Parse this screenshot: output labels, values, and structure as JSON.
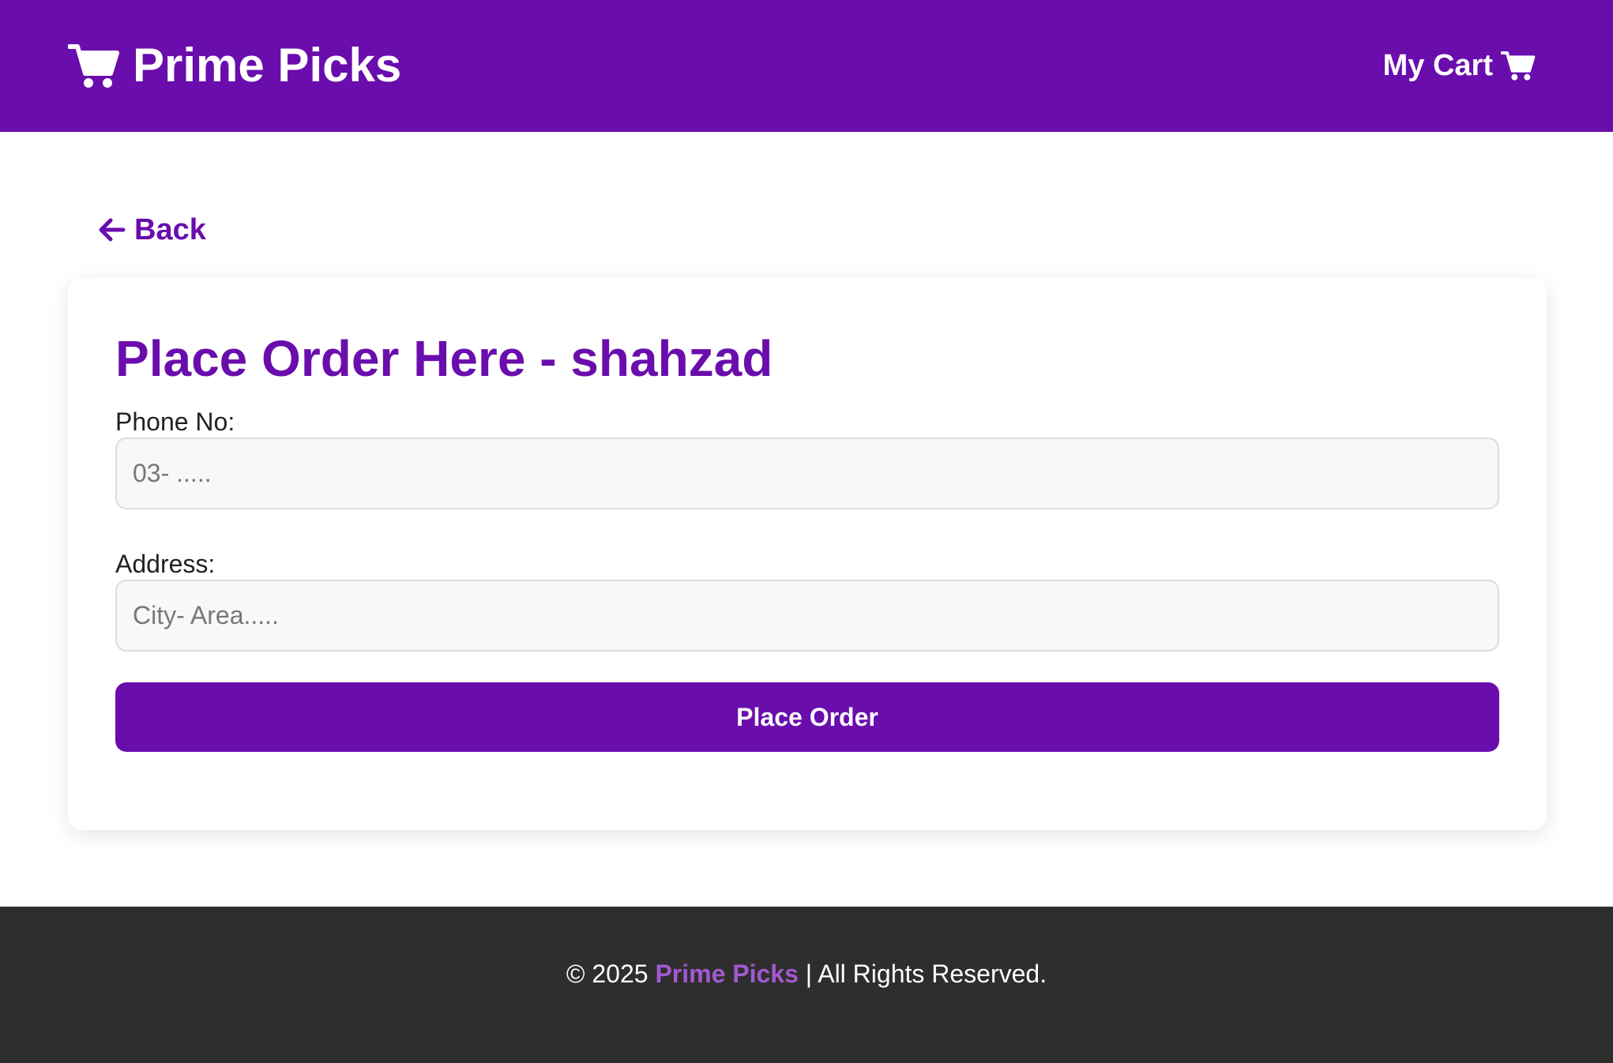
{
  "header": {
    "brand_name": "Prime Picks",
    "cart_label": "My Cart",
    "brand_icon": "cart-icon",
    "cart_icon": "cart-icon"
  },
  "nav": {
    "back_label": "Back",
    "back_icon": "arrow-left-icon"
  },
  "form": {
    "title": "Place Order Here - shahzad",
    "phone": {
      "label": "Phone No:",
      "placeholder": "03- .....",
      "value": ""
    },
    "address": {
      "label": "Address:",
      "placeholder": "City- Area.....",
      "value": ""
    },
    "submit_label": "Place Order"
  },
  "footer": {
    "prefix": "© 2025 ",
    "brand": "Prime Picks",
    "suffix": " | All Rights Reserved."
  },
  "colors": {
    "primary": "#6a0dad",
    "footer_bg": "#2e2e2e",
    "footer_brand": "#a259d1",
    "input_bg": "#f8f8f8"
  }
}
